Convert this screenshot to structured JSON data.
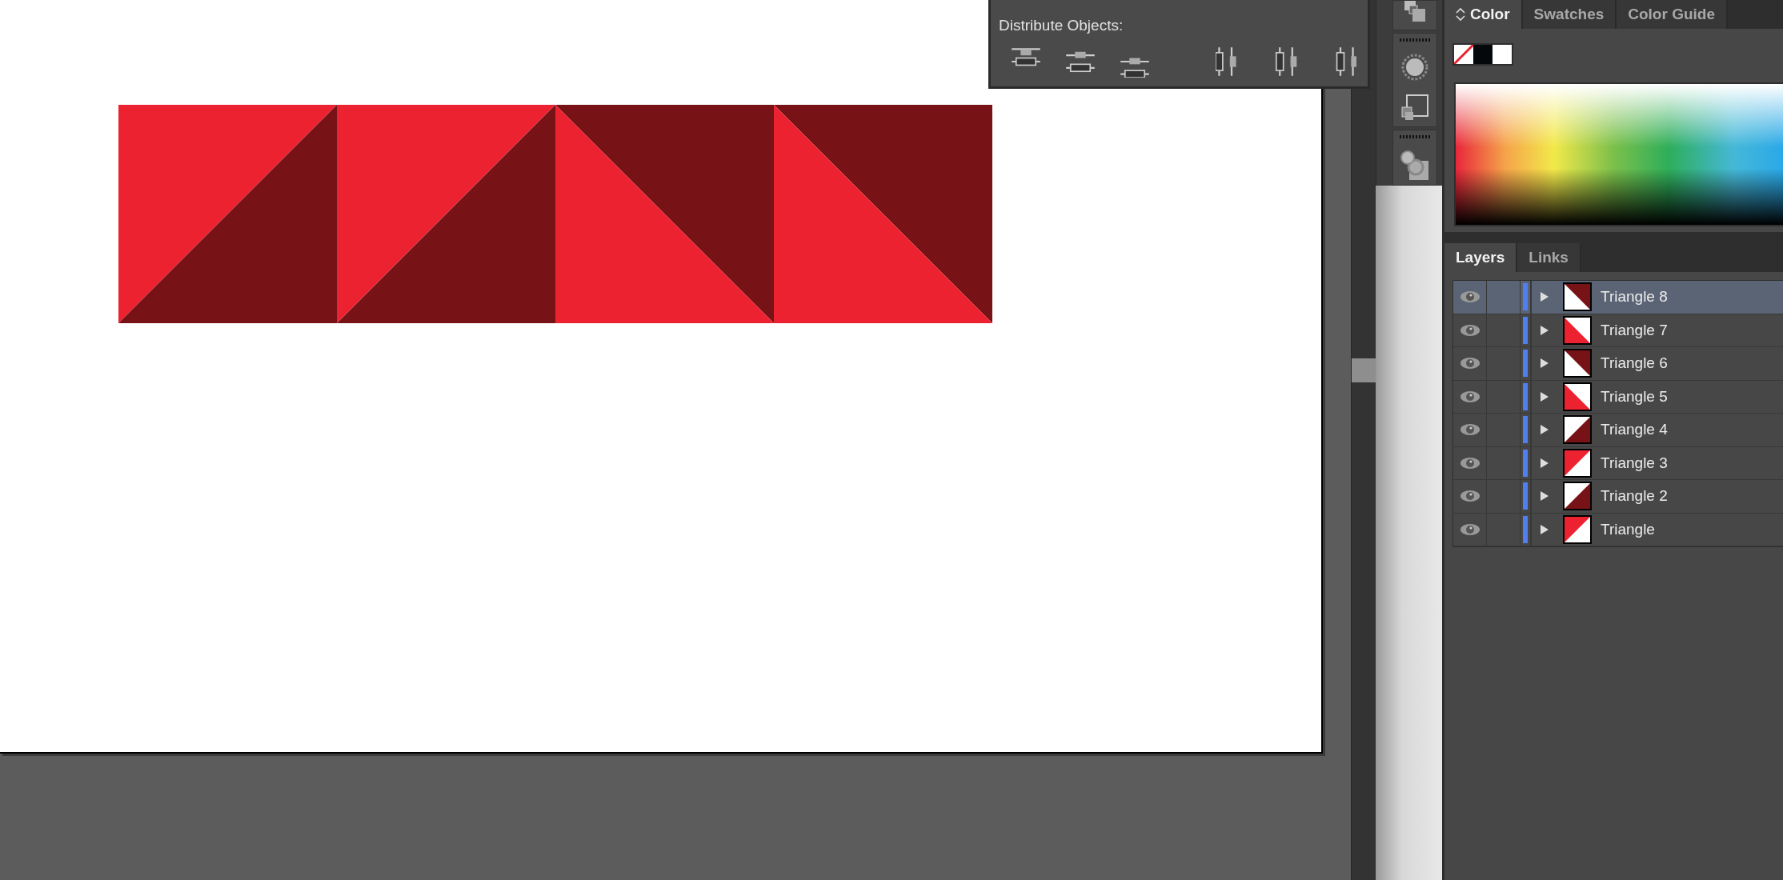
{
  "artboard": {
    "tiles": [
      {
        "kind": "rising"
      },
      {
        "kind": "rising"
      },
      {
        "kind": "falling"
      },
      {
        "kind": "falling"
      }
    ]
  },
  "distribute_panel": {
    "title": "Distribute Objects:"
  },
  "color_panel": {
    "tabs": [
      {
        "label": "Color",
        "selected": true
      },
      {
        "label": "Swatches",
        "selected": false
      },
      {
        "label": "Color Guide",
        "selected": false
      }
    ]
  },
  "layers_panel": {
    "tabs": [
      {
        "label": "Layers",
        "selected": true
      },
      {
        "label": "Links",
        "selected": false
      }
    ],
    "layers": [
      {
        "name": "Triangle 8",
        "selected": true,
        "visible": true,
        "expanded": false,
        "thumbnail": {
          "kind": "northeast",
          "color": "#771217"
        }
      },
      {
        "name": "Triangle 7",
        "selected": false,
        "visible": true,
        "expanded": false,
        "thumbnail": {
          "kind": "southwest",
          "color": "#ec2230"
        }
      },
      {
        "name": "Triangle 6",
        "selected": false,
        "visible": true,
        "expanded": false,
        "thumbnail": {
          "kind": "northeast",
          "color": "#771217"
        }
      },
      {
        "name": "Triangle 5",
        "selected": false,
        "visible": true,
        "expanded": false,
        "thumbnail": {
          "kind": "southwest",
          "color": "#ec2230"
        }
      },
      {
        "name": "Triangle 4",
        "selected": false,
        "visible": true,
        "expanded": false,
        "thumbnail": {
          "kind": "southeast",
          "color": "#771217"
        }
      },
      {
        "name": "Triangle 3",
        "selected": false,
        "visible": true,
        "expanded": false,
        "thumbnail": {
          "kind": "northwest",
          "color": "#ec2230"
        }
      },
      {
        "name": "Triangle 2",
        "selected": false,
        "visible": true,
        "expanded": false,
        "thumbnail": {
          "kind": "southeast",
          "color": "#771217"
        }
      },
      {
        "name": "Triangle",
        "selected": false,
        "visible": true,
        "expanded": false,
        "thumbnail": {
          "kind": "northwest",
          "color": "#ec2230"
        }
      }
    ]
  }
}
